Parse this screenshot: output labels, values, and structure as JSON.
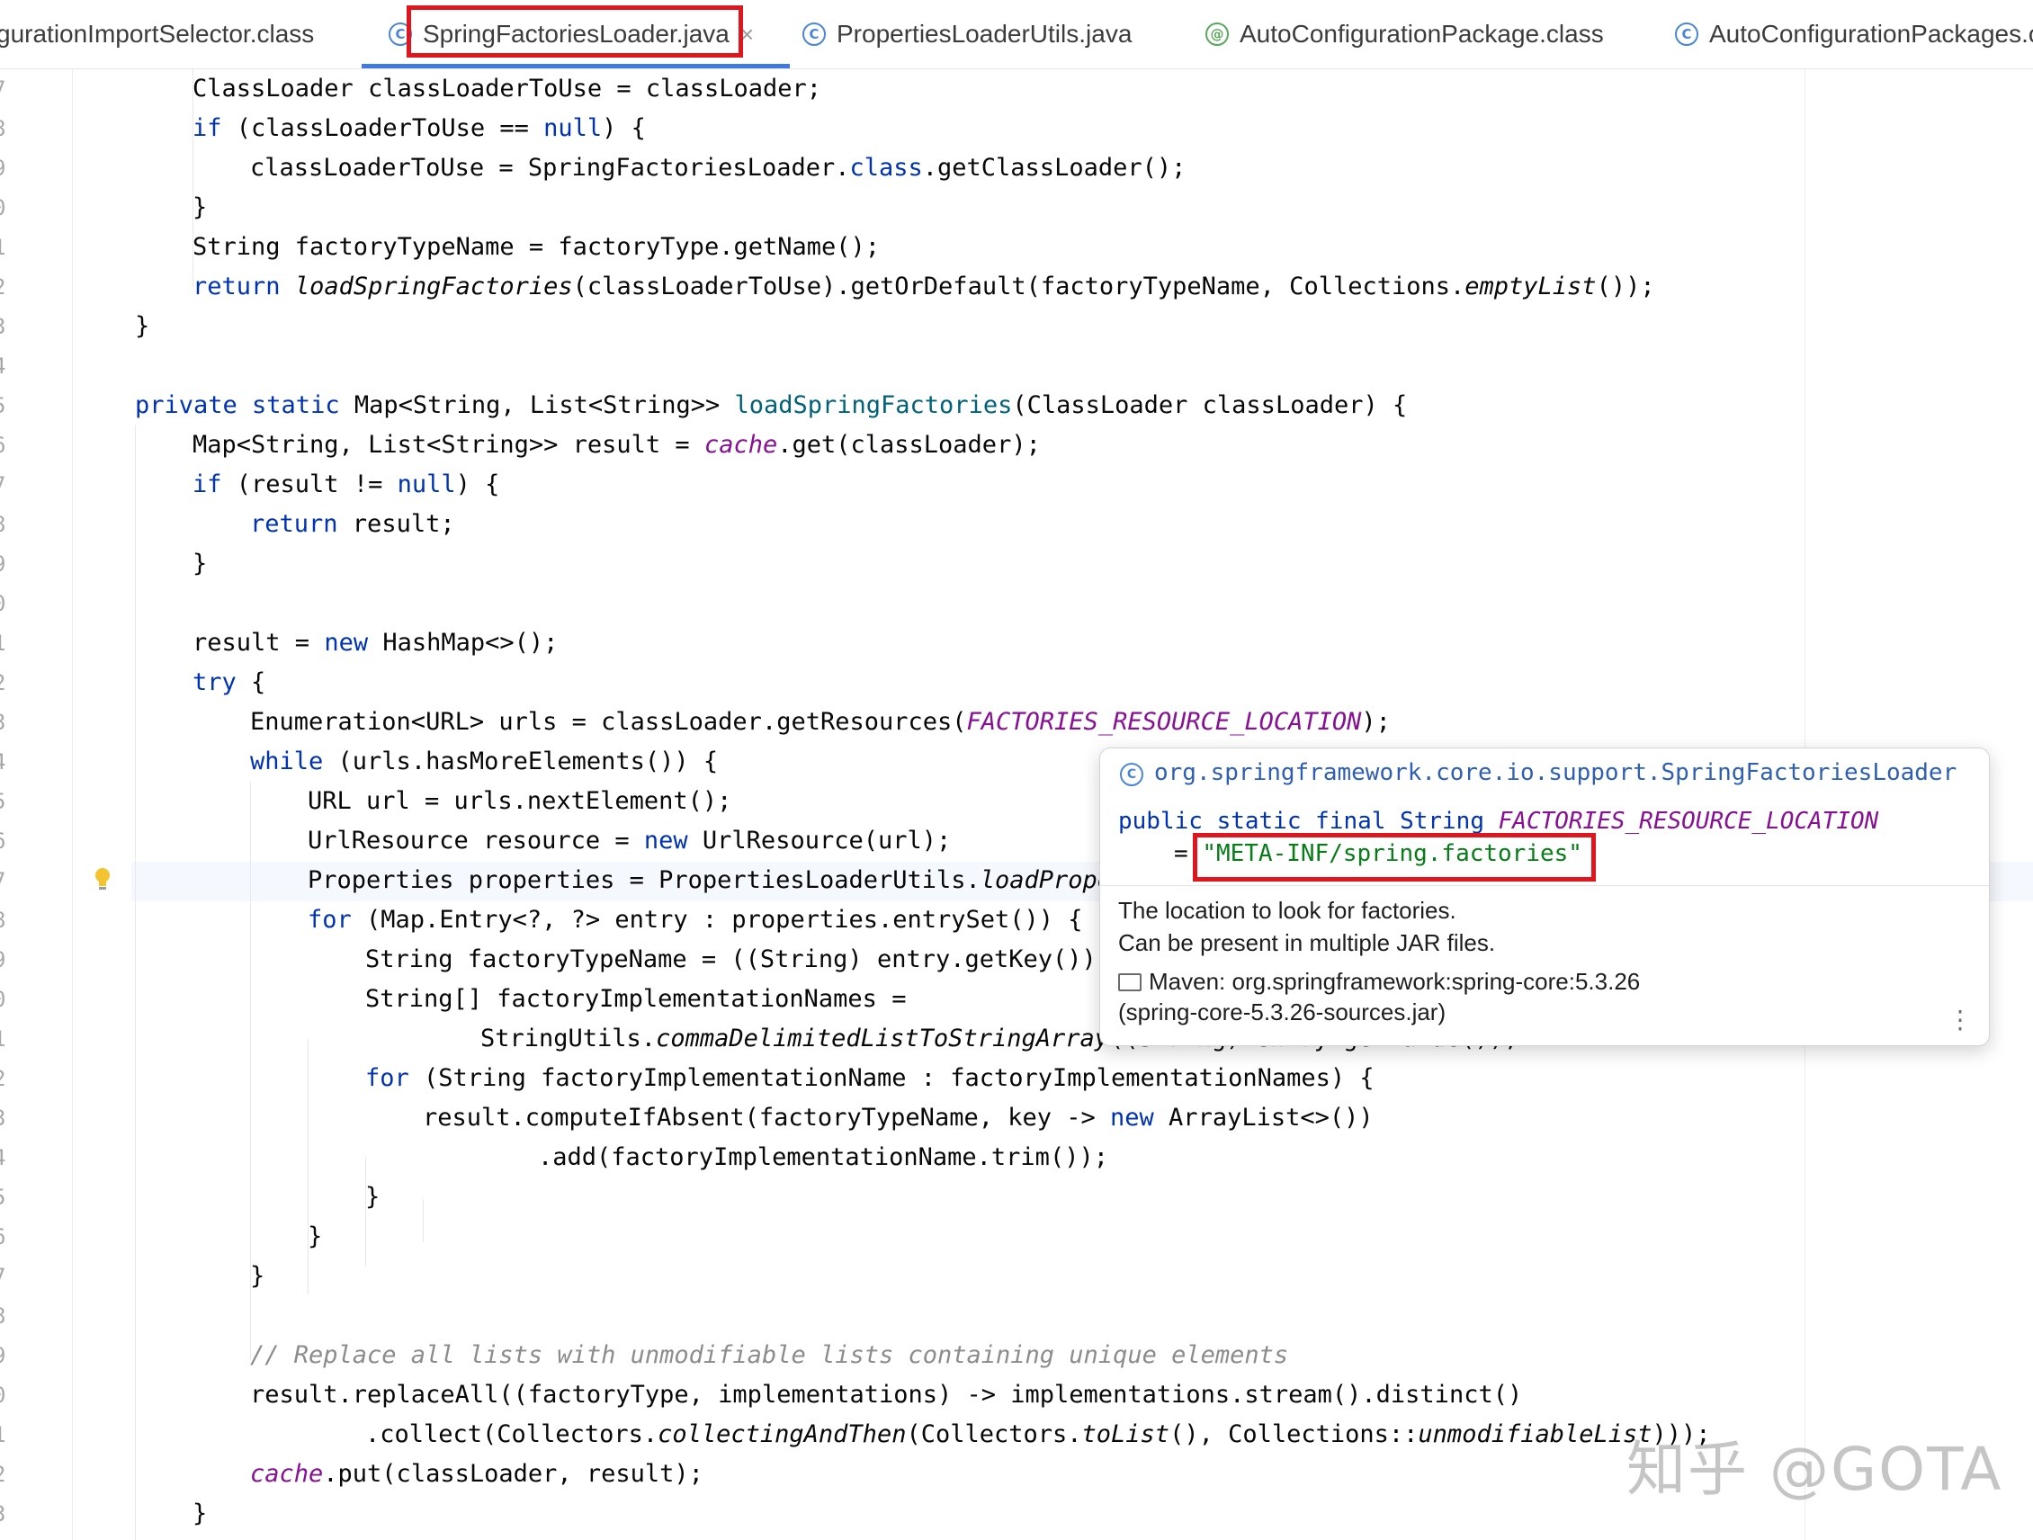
{
  "tabs": [
    {
      "label": "gurationImportSelector.class",
      "icon": "class-icon",
      "active": false
    },
    {
      "label": "SpringFactoriesLoader.java",
      "icon": "class-icon",
      "active": true,
      "close": "×"
    },
    {
      "label": "PropertiesLoaderUtils.java",
      "icon": "class-icon",
      "active": false
    },
    {
      "label": "AutoConfigurationPackage.class",
      "icon": "annotation-icon",
      "active": false
    },
    {
      "label": "AutoConfigurationPackages.c",
      "icon": "class-icon",
      "active": false
    }
  ],
  "line_numbers": [
    "7",
    "8",
    "9",
    "0",
    "1",
    "2",
    "3",
    "4",
    "5",
    "6",
    "7",
    "8",
    "9",
    "0",
    "1",
    "2",
    "3",
    "4",
    "5",
    "6",
    "7",
    "8",
    "9",
    "0",
    "1",
    "2",
    "3",
    "4",
    "5",
    "6",
    "7",
    "8",
    "9",
    "0",
    "1",
    "2",
    "3"
  ],
  "popup": {
    "fqcn": "org.springframework.core.io.support.SpringFactoriesLoader",
    "decl_prefix": "public static final String ",
    "decl_field": "FACTORIES_RESOURCE_LOCATION",
    "eq": "= ",
    "value": "\"META-INF/spring.factories\"",
    "desc_line1": "The location to look for factories.",
    "desc_line2": "Can be present in multiple JAR files.",
    "maven_line1": "Maven: org.springframework:spring-core:5.3.26",
    "maven_line2": "(spring-core-5.3.26-sources.jar)",
    "menu": "⋮"
  },
  "watermark": "知乎 @GOTA",
  "colors": {
    "keyword": "#0033b3",
    "field": "#871094",
    "string": "#067d17",
    "highlight_box": "#e0161e"
  }
}
